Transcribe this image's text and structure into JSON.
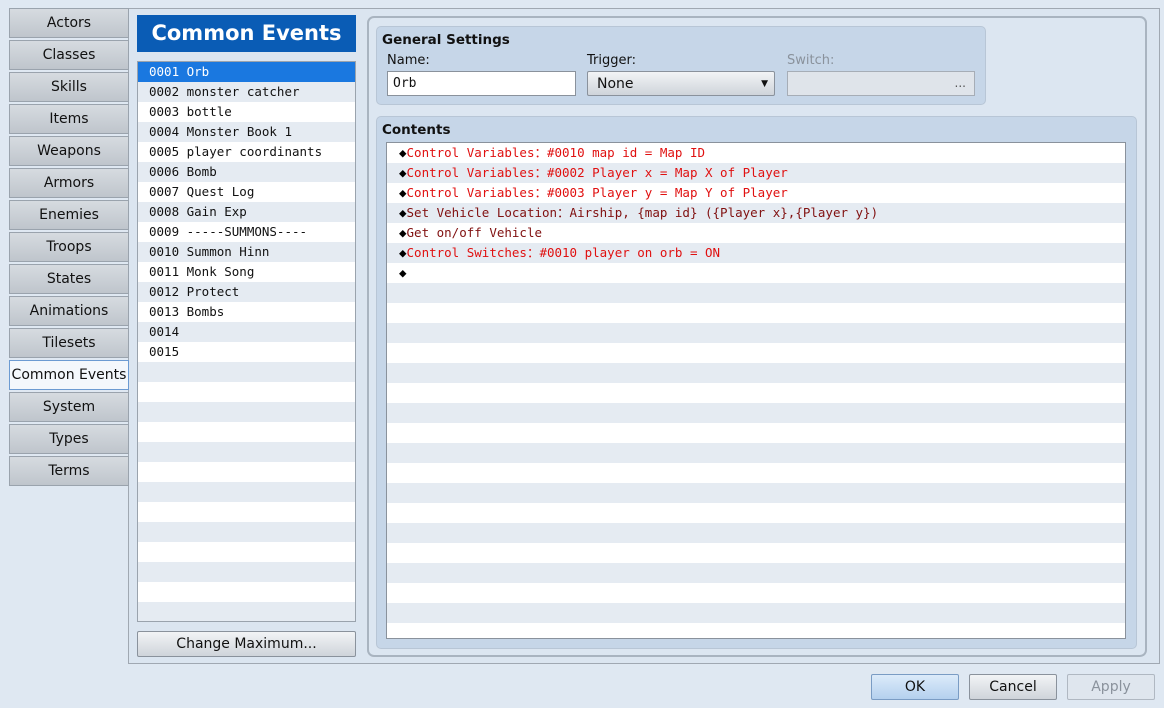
{
  "tabs": [
    "Actors",
    "Classes",
    "Skills",
    "Items",
    "Weapons",
    "Armors",
    "Enemies",
    "Troops",
    "States",
    "Animations",
    "Tilesets",
    "Common Events",
    "System",
    "Types",
    "Terms"
  ],
  "selected_tab": "Common Events",
  "banner": "Common Events",
  "events": [
    "0001 Orb",
    "0002 monster catcher",
    "0003 bottle",
    "0004 Monster Book 1",
    "0005 player coordinants",
    "0006 Bomb",
    "0007 Quest Log",
    "0008 Gain Exp",
    "0009 -----SUMMONS----",
    "0010 Summon Hinn",
    "0011 Monk Song",
    "0012 Protect",
    "0013 Bombs",
    "0014",
    "0015"
  ],
  "change_max": "Change Maximum...",
  "general": {
    "title": "General Settings",
    "name_label": "Name:",
    "name_value": "Orb",
    "trigger_label": "Trigger:",
    "trigger_value": "None",
    "switch_label": "Switch:",
    "switch_button": "..."
  },
  "contents": {
    "title": "Contents",
    "commands": [
      {
        "marker": "◆",
        "text": "Control Variables：#0010 map id = Map ID",
        "color": "red"
      },
      {
        "marker": "◆",
        "text": "Control Variables：#0002 Player x = Map X of Player",
        "color": "red"
      },
      {
        "marker": "◆",
        "text": "Control Variables：#0003 Player y = Map Y of Player",
        "color": "red"
      },
      {
        "marker": "◆",
        "text": "Set Vehicle Location：Airship, {map id} ({Player x},{Player y})",
        "color": "dred"
      },
      {
        "marker": "◆",
        "text": "Get on/off Vehicle",
        "color": "dred"
      },
      {
        "marker": "◆",
        "text": "Control Switches：#0010 player on orb = ON",
        "color": "red"
      },
      {
        "marker": "◆",
        "text": "",
        "color": "red"
      }
    ]
  },
  "buttons": {
    "ok": "OK",
    "cancel": "Cancel",
    "apply": "Apply"
  }
}
